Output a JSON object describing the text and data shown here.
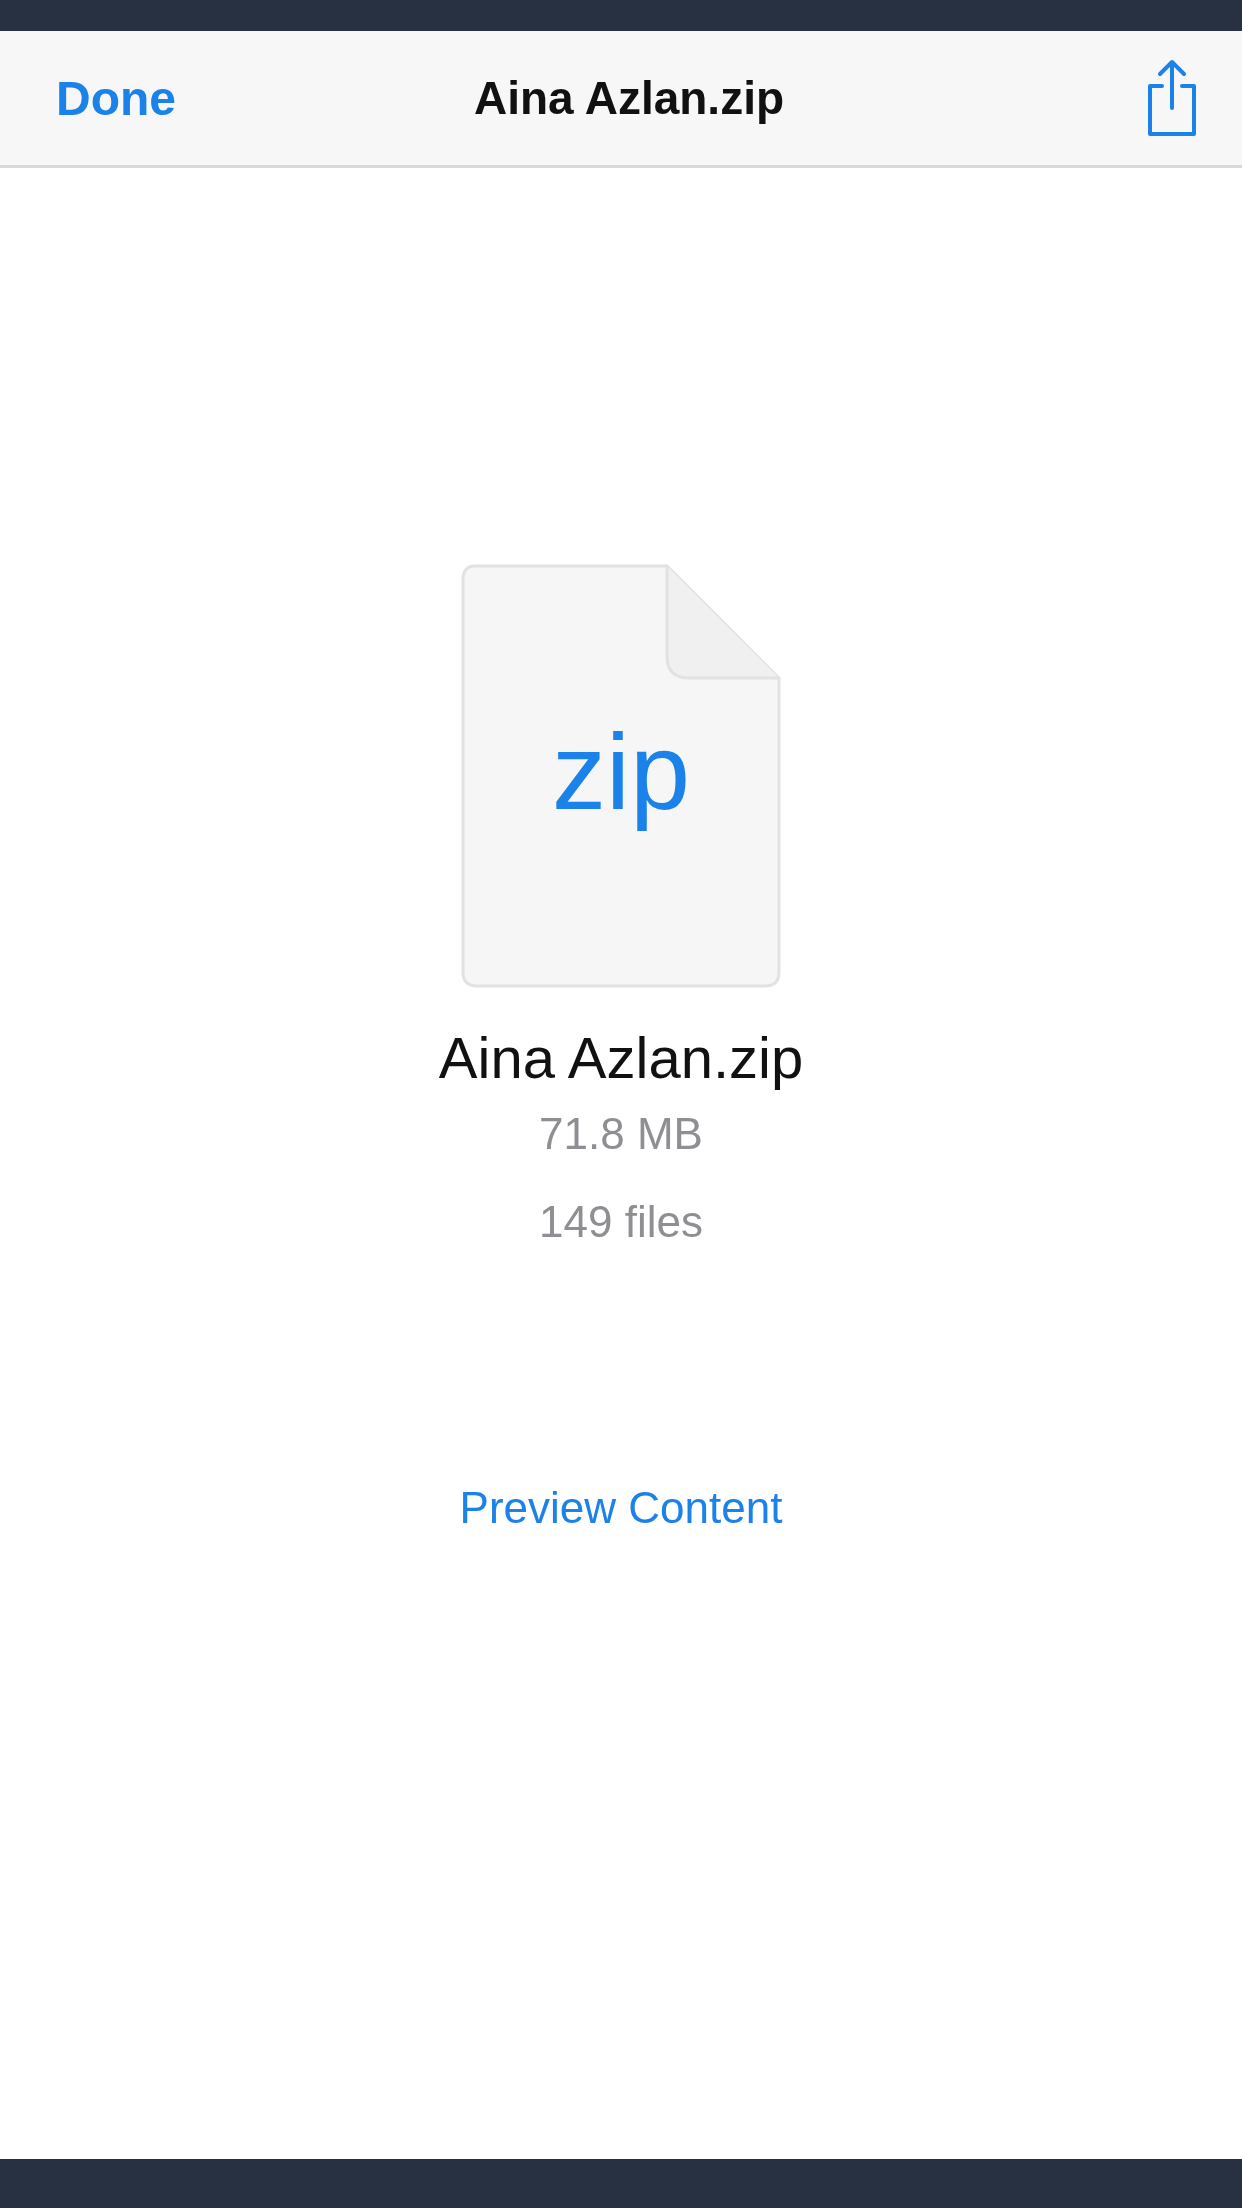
{
  "nav_bar": {
    "done_button": "Done",
    "title": "Aina Azlan.zip"
  },
  "file": {
    "type_label": "zip",
    "name": "Aina Azlan.zip",
    "size": "71.8 MB",
    "count": "149 files"
  },
  "preview_link": "Preview Content"
}
